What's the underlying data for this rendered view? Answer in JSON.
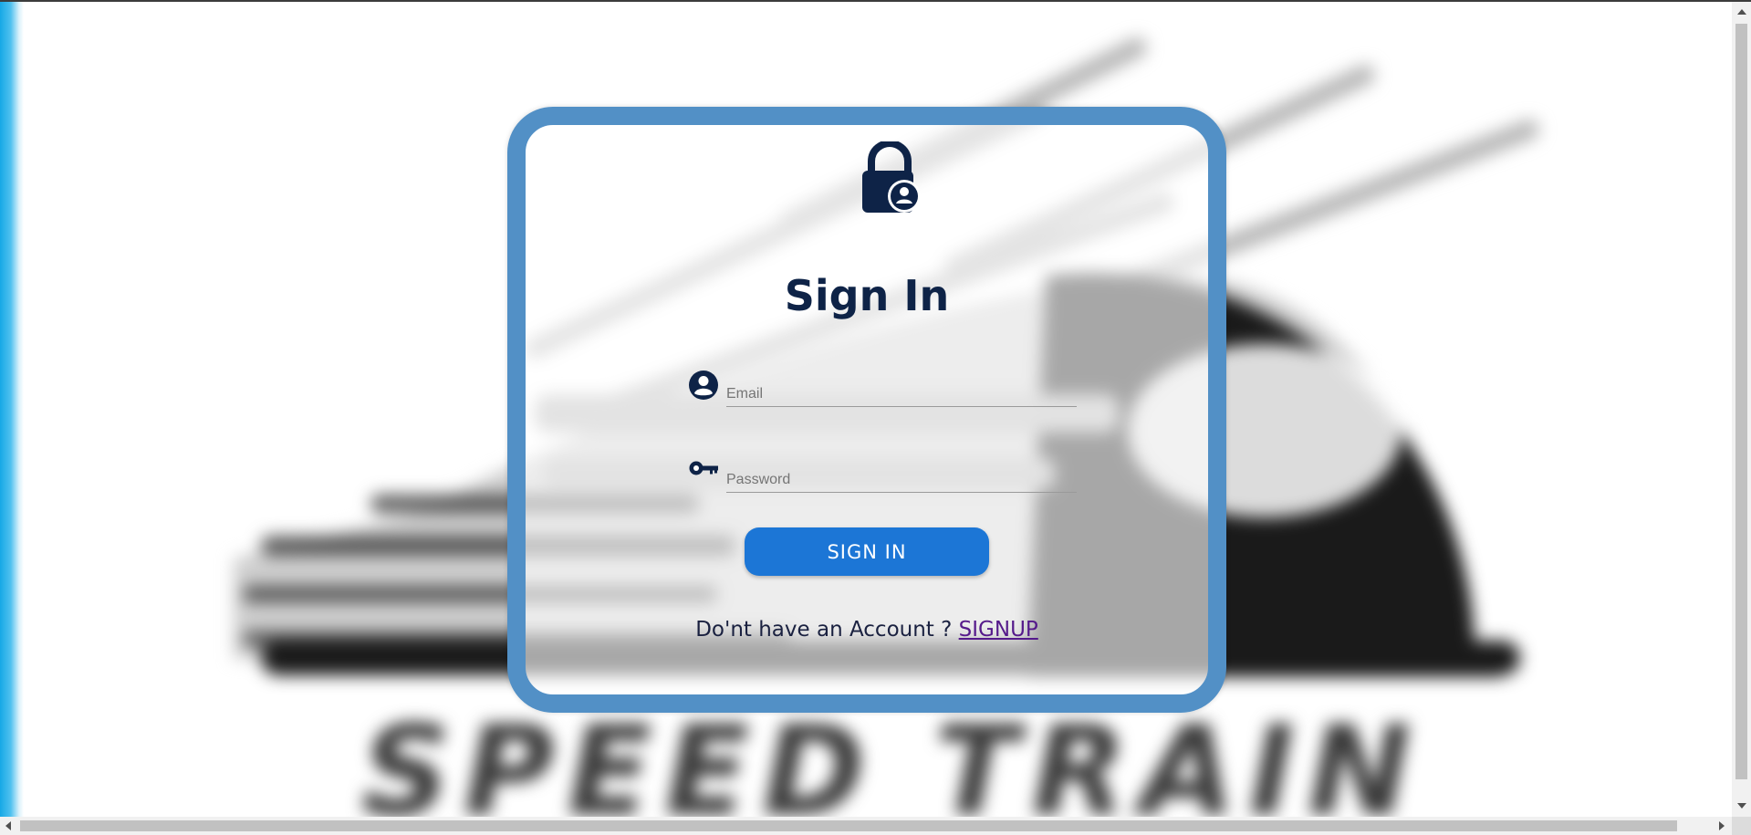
{
  "background": {
    "brand_text": "SPEED TRAIN",
    "image": "blurred-train-logo"
  },
  "card": {
    "icon": "lock-user-icon",
    "title": "Sign In",
    "email": {
      "icon": "user-circle-icon",
      "placeholder": "Email",
      "value": ""
    },
    "password": {
      "icon": "key-icon",
      "placeholder": "Password",
      "value": ""
    },
    "submit_label": "SIGN IN",
    "signup_prompt": "Do'nt have an Account ? ",
    "signup_link": "SIGNUP"
  },
  "colors": {
    "card_border": "#5290c6",
    "button": "#1c76d6",
    "title": "#0e2347",
    "link": "#551a8b"
  }
}
